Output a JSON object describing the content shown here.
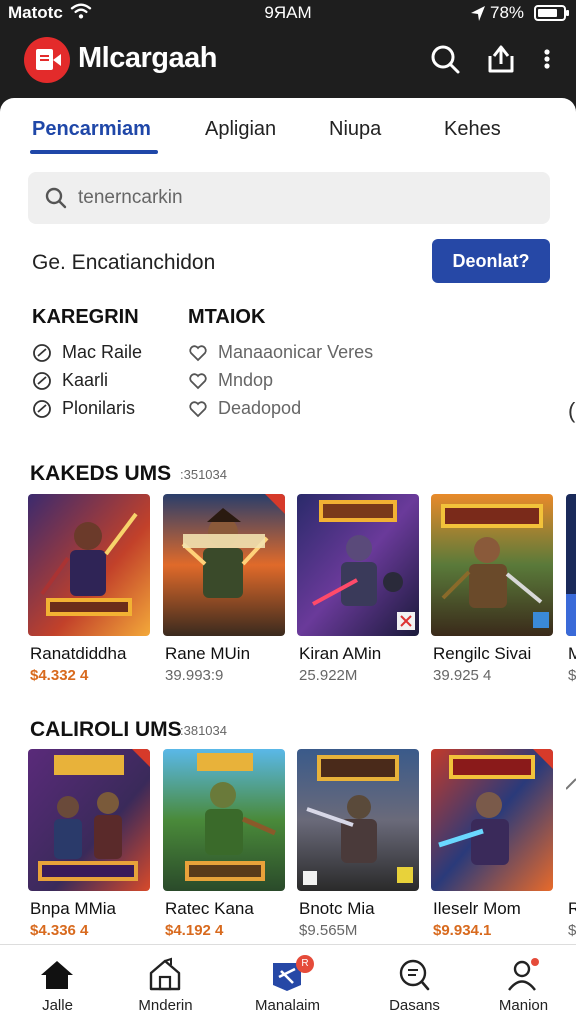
{
  "status_bar": {
    "carrier": "Matotc",
    "time": "9ЯAM",
    "battery": "78%",
    "battery_level_percent": 78
  },
  "app_bar": {
    "title": "Mlcargaah",
    "icons": [
      "search-icon",
      "share-icon",
      "more-vert-icon"
    ],
    "logo_color": "#e32b2b"
  },
  "tabs": [
    "Pencarmiam",
    "Apligian",
    "Niupa",
    "Kehes"
  ],
  "active_tab_index": 0,
  "search": {
    "placeholder": "tenerncarkin"
  },
  "filter": {
    "text": "Ge. Encatianchidon",
    "download_label": "Deonlat?"
  },
  "categories": {
    "heading": "KAREGRIN",
    "items": [
      "Mac Raile",
      "Kaarli",
      "Plonilaris"
    ]
  },
  "moods": {
    "heading": "MTAIOK",
    "items": [
      "Manaaonicar Veres",
      "Mndop",
      "Deadopod"
    ]
  },
  "sections": [
    {
      "title": "KAKEDS UMS",
      "count": ":351034",
      "cards": [
        {
          "name": "Ranatdiddha",
          "price": "$4.332 4",
          "price_style": "orange"
        },
        {
          "name": "Rane MUin",
          "price": "39.993:9",
          "price_style": "grey"
        },
        {
          "name": "Kiran AMin",
          "price": "25.922M",
          "price_style": "grey"
        },
        {
          "name": "Rengilc Sivai",
          "price": "39.925 4",
          "price_style": "grey"
        },
        {
          "name": "M",
          "price": "$",
          "price_style": "grey"
        }
      ]
    },
    {
      "title": "CALIROLI UMS",
      "count": ":381034",
      "cards": [
        {
          "name": "Bnpa MMia",
          "price": "$4.336 4",
          "price_style": "orange"
        },
        {
          "name": "Ratec Kana",
          "price": "$4.192 4",
          "price_style": "orange"
        },
        {
          "name": "Bnotc Mia",
          "price": "$9.565M",
          "price_style": "grey"
        },
        {
          "name": "Ileselr Mom",
          "price": "$9.934.1",
          "price_style": "orange"
        },
        {
          "name": "R",
          "price": "$",
          "price_style": "grey"
        }
      ]
    }
  ],
  "bottom_nav": [
    {
      "label": "Jalle",
      "icon": "home-icon"
    },
    {
      "label": "Mnderin",
      "icon": "store-icon"
    },
    {
      "label": "Manalaim",
      "icon": "app-store-icon",
      "badge": "R"
    },
    {
      "label": "Dasans",
      "icon": "search-list-icon"
    },
    {
      "label": "Manion",
      "icon": "profile-icon"
    }
  ],
  "colors": {
    "accent_blue": "#1f47a8",
    "button_blue": "#2648a6",
    "price_orange": "#d86a1e",
    "top_bar": "#1e1e1e"
  }
}
